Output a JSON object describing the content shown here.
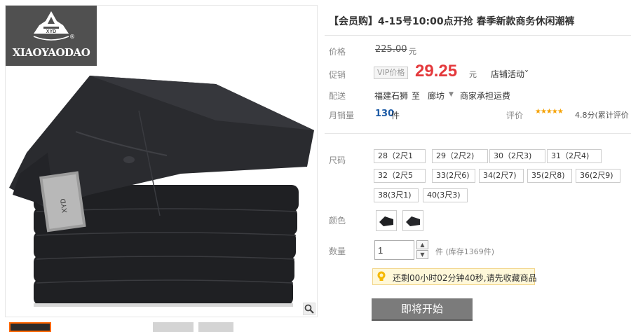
{
  "brand": {
    "logo_text": "XIAOYAODAO",
    "logo_mark_text": "XYD"
  },
  "product": {
    "title": "【会员购】4-15号10:00点开抢 春季新款商务休闲潮裤"
  },
  "price": {
    "label": "价格",
    "original": "225.00",
    "currency_unit": "元"
  },
  "promo": {
    "label": "促销",
    "vip_tag": "VIP价格",
    "price": "29.25",
    "currency_unit": "元",
    "shop_activity": "店铺活动˅"
  },
  "shipping": {
    "label": "配送",
    "from": "福建石狮",
    "to_word": "至",
    "destination": "廊坊",
    "fee_text": "商家承担运费"
  },
  "sales": {
    "label": "月销量",
    "count": "130",
    "unit": "件",
    "review_label": "评价",
    "stars": "★★★★★",
    "rating_text": "4.8分(累计评价"
  },
  "sizes": {
    "label": "尺码",
    "options": [
      "28（2尺1",
      "29（2尺2)",
      "30（2尺3)",
      "31（2尺4)",
      "32（2尺5",
      "33(2尺6)",
      "34(2尺7)",
      "35(2尺8)",
      "36(2尺9)",
      "38(3尺1)",
      "40(3尺3)"
    ]
  },
  "colors": {
    "label": "颜色"
  },
  "quantity": {
    "label": "数量",
    "value": "1",
    "unit_stock": "件 (库存1369件)"
  },
  "countdown": {
    "text": "还剩00小时02分钟40秒,请先收藏商品"
  },
  "buy": {
    "button_label": "即将开始"
  },
  "colors_theme": {
    "price_red": "#e4393c",
    "link_blue": "#1d5ba6",
    "star_gold": "#f5a100",
    "button_gray": "#7b7b7b"
  }
}
